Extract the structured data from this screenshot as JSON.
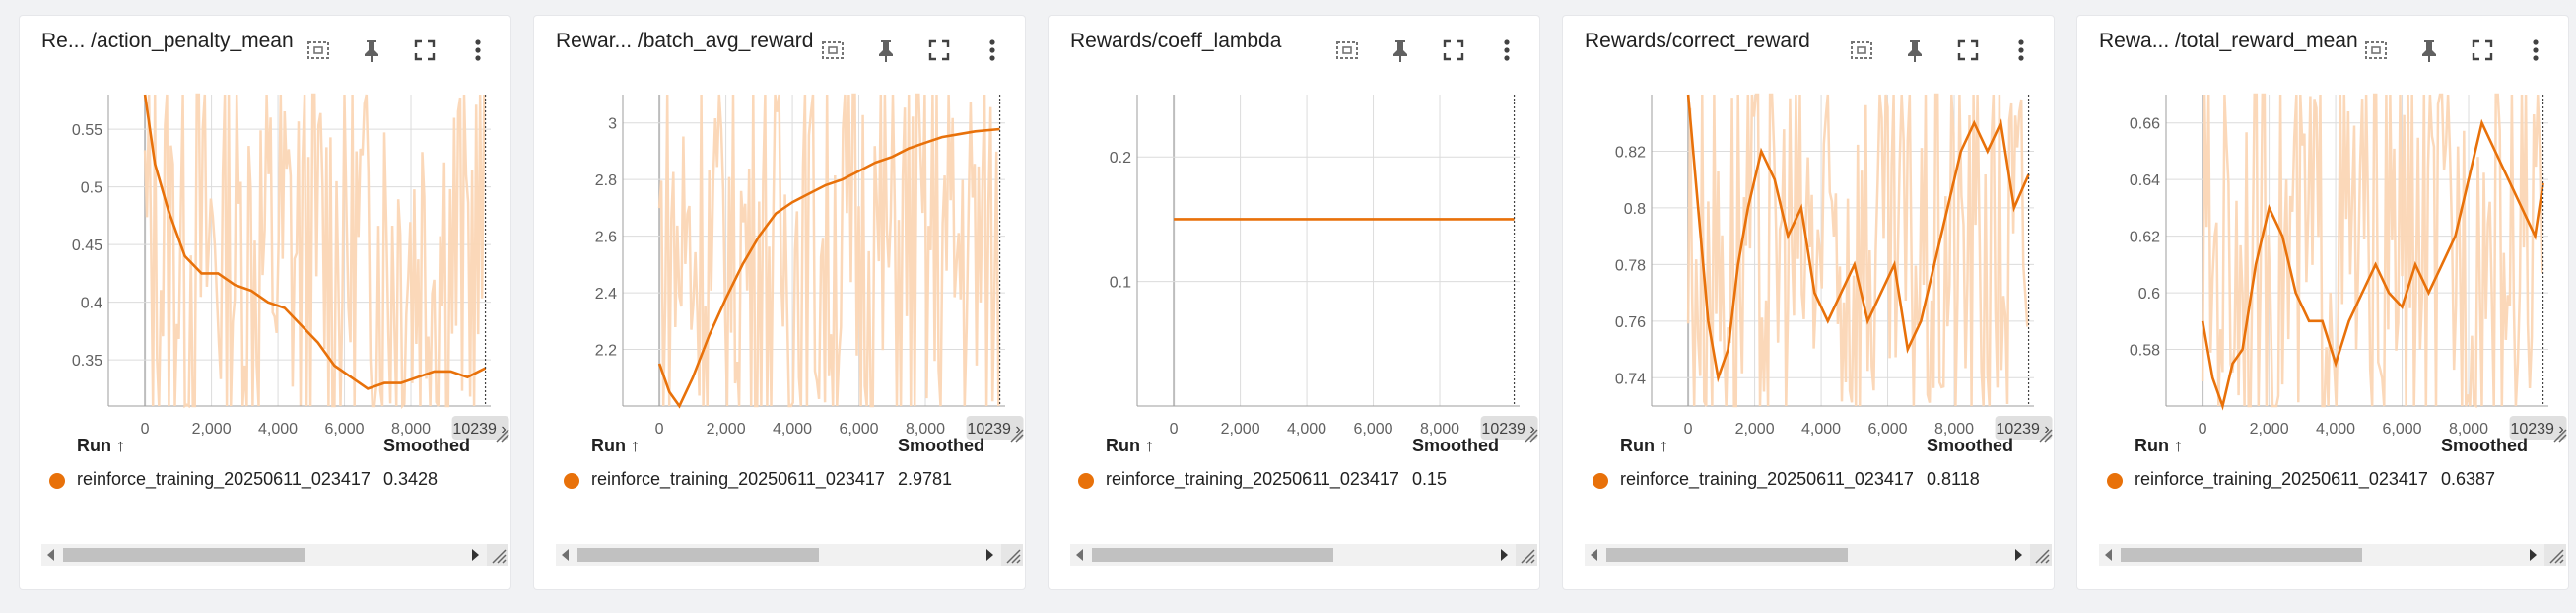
{
  "theme": {
    "accent": "#e8710a",
    "raw_fill": "#fbd6b5",
    "grid": "#dcdcdc"
  },
  "icons": [
    "fit-domain-icon",
    "pin-icon",
    "fullscreen-icon",
    "more-vert-icon"
  ],
  "legend": {
    "run_header": "Run ↑",
    "smoothed_header": "Smoothed"
  },
  "cards": [
    {
      "title": "Re... /action_penalty_mean",
      "run": "reinforce_training_20250611_023417",
      "smoothed": "0.3428",
      "last_step": "10239"
    },
    {
      "title": "Rewar... /batch_avg_reward",
      "run": "reinforce_training_20250611_023417",
      "smoothed": "2.9781",
      "last_step": "10239"
    },
    {
      "title": "Rewards/coeff_lambda",
      "run": "reinforce_training_20250611_023417",
      "smoothed": "0.15",
      "last_step": "10239"
    },
    {
      "title": "Rewards/correct_reward",
      "run": "reinforce_training_20250611_023417",
      "smoothed": "0.8118",
      "last_step": "10239"
    },
    {
      "title": "Rewa... /total_reward_mean",
      "run": "reinforce_training_20250611_023417",
      "smoothed": "0.6387",
      "last_step": "10239"
    }
  ],
  "chart_data": [
    {
      "type": "line",
      "title": "Re... /action_penalty_mean",
      "xticks": [
        "0",
        "2,000",
        "4,000",
        "6,000",
        "8,000"
      ],
      "yticks": [
        "0.35",
        "0.4",
        "0.45",
        "0.5",
        "0.55"
      ],
      "xlim": [
        -1100,
        10400
      ],
      "ylim": [
        0.31,
        0.58
      ],
      "grid": true,
      "series": [
        {
          "name": "reinforce_training_20250611_023417",
          "x": [
            0,
            300,
            700,
            1200,
            1700,
            2200,
            2700,
            3200,
            3700,
            4200,
            4700,
            5200,
            5700,
            6200,
            6700,
            7200,
            7700,
            8200,
            8700,
            9200,
            9700,
            10239
          ],
          "y": [
            0.58,
            0.52,
            0.48,
            0.44,
            0.425,
            0.425,
            0.415,
            0.41,
            0.4,
            0.395,
            0.38,
            0.365,
            0.345,
            0.335,
            0.325,
            0.33,
            0.33,
            0.335,
            0.34,
            0.34,
            0.335,
            0.3428
          ]
        }
      ]
    },
    {
      "type": "line",
      "title": "Rewar... /batch_avg_reward",
      "xticks": [
        "0",
        "2,000",
        "4,000",
        "6,000",
        "8,000"
      ],
      "yticks": [
        "2.2",
        "2.4",
        "2.6",
        "2.8",
        "3"
      ],
      "xlim": [
        -1100,
        10400
      ],
      "ylim": [
        2.0,
        3.1
      ],
      "grid": true,
      "series": [
        {
          "name": "reinforce_training_20250611_023417",
          "x": [
            0,
            300,
            600,
            1000,
            1500,
            2000,
            2500,
            3000,
            3500,
            4000,
            4500,
            5000,
            5500,
            6000,
            6500,
            7000,
            7500,
            8000,
            8500,
            9000,
            9500,
            10239
          ],
          "y": [
            2.15,
            2.05,
            2.0,
            2.1,
            2.25,
            2.38,
            2.5,
            2.6,
            2.68,
            2.72,
            2.75,
            2.78,
            2.8,
            2.83,
            2.86,
            2.88,
            2.91,
            2.93,
            2.95,
            2.96,
            2.97,
            2.9781
          ]
        }
      ]
    },
    {
      "type": "line",
      "title": "Rewards/coeff_lambda",
      "xticks": [
        "0",
        "2,000",
        "4,000",
        "6,000",
        "8,000"
      ],
      "yticks": [
        "0.1",
        "0.2"
      ],
      "xlim": [
        -1100,
        10400
      ],
      "ylim": [
        0.0,
        0.25
      ],
      "grid": true,
      "series": [
        {
          "name": "reinforce_training_20250611_023417",
          "x": [
            0,
            10239
          ],
          "y": [
            0.15,
            0.15
          ]
        }
      ]
    },
    {
      "type": "line",
      "title": "Rewards/correct_reward",
      "xticks": [
        "0",
        "2,000",
        "4,000",
        "6,000",
        "8,000"
      ],
      "yticks": [
        "0.74",
        "0.76",
        "0.78",
        "0.8",
        "0.82"
      ],
      "xlim": [
        -1100,
        10400
      ],
      "ylim": [
        0.73,
        0.84
      ],
      "grid": true,
      "series": [
        {
          "name": "reinforce_training_20250611_023417",
          "x": [
            0,
            300,
            600,
            900,
            1200,
            1500,
            1800,
            2200,
            2600,
            3000,
            3400,
            3800,
            4200,
            4600,
            5000,
            5400,
            5800,
            6200,
            6600,
            7000,
            7400,
            7800,
            8200,
            8600,
            9000,
            9400,
            9800,
            10239
          ],
          "y": [
            0.84,
            0.8,
            0.76,
            0.74,
            0.75,
            0.78,
            0.8,
            0.82,
            0.81,
            0.79,
            0.8,
            0.77,
            0.76,
            0.77,
            0.78,
            0.76,
            0.77,
            0.78,
            0.75,
            0.76,
            0.78,
            0.8,
            0.82,
            0.83,
            0.82,
            0.83,
            0.8,
            0.8118
          ]
        }
      ]
    },
    {
      "type": "line",
      "title": "Rewa... /total_reward_mean",
      "xticks": [
        "0",
        "2,000",
        "4,000",
        "6,000",
        "8,000"
      ],
      "yticks": [
        "0.58",
        "0.6",
        "0.62",
        "0.64",
        "0.66"
      ],
      "xlim": [
        -1100,
        10400
      ],
      "ylim": [
        0.56,
        0.67
      ],
      "grid": true,
      "series": [
        {
          "name": "reinforce_training_20250611_023417",
          "x": [
            0,
            300,
            600,
            900,
            1200,
            1600,
            2000,
            2400,
            2800,
            3200,
            3600,
            4000,
            4400,
            4800,
            5200,
            5600,
            6000,
            6400,
            6800,
            7200,
            7600,
            8000,
            8400,
            8800,
            9200,
            9600,
            10000,
            10239
          ],
          "y": [
            0.59,
            0.57,
            0.56,
            0.575,
            0.58,
            0.61,
            0.63,
            0.62,
            0.6,
            0.59,
            0.59,
            0.575,
            0.59,
            0.6,
            0.61,
            0.6,
            0.595,
            0.61,
            0.6,
            0.61,
            0.62,
            0.64,
            0.66,
            0.65,
            0.64,
            0.63,
            0.62,
            0.6387
          ]
        }
      ]
    }
  ]
}
